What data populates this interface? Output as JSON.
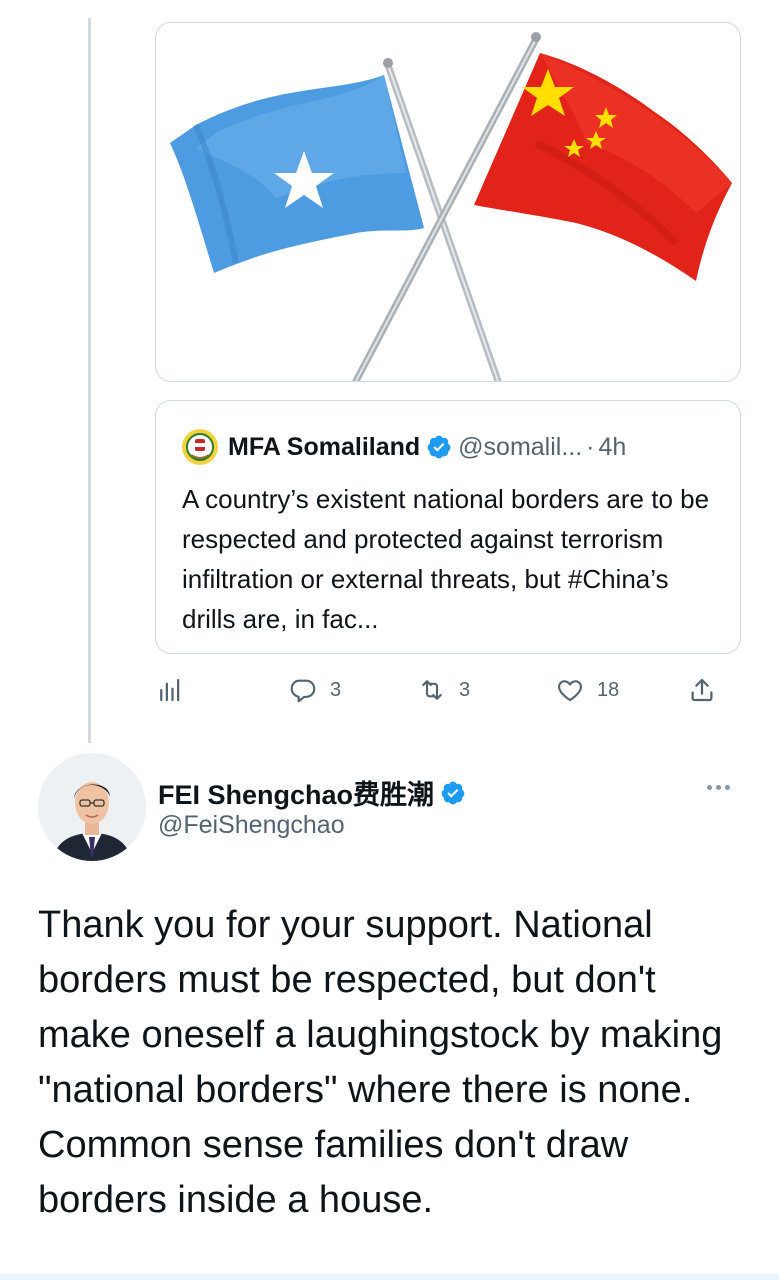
{
  "media": {
    "image_alt": "Flags of Somalia and China crossed",
    "colors": {
      "left_flag": "#4d9be0",
      "right_flag": "#e2231a",
      "star_yellow": "#ffde00"
    }
  },
  "quote": {
    "name": "MFA Somaliland",
    "handle": "@somalil...",
    "dot": "·",
    "time": "4h",
    "text": "A country’s existent national borders are to be respected and protected against terrorism infiltration or external threats, but #China’s drills are, in fac..."
  },
  "actions": {
    "analytics_icon": "bar-chart-icon",
    "replies": "3",
    "retweets": "3",
    "likes": "18"
  },
  "author": {
    "name": "FEI Shengchao费胜潮",
    "handle": "@FeiShengchao",
    "verified_color": "#1d9bf0"
  },
  "tweet": {
    "text": "Thank you for your support. National borders must be respected, but don't make oneself a laughingstock by making \"national borders\" where there is none. Common sense families don't draw borders inside a house."
  }
}
